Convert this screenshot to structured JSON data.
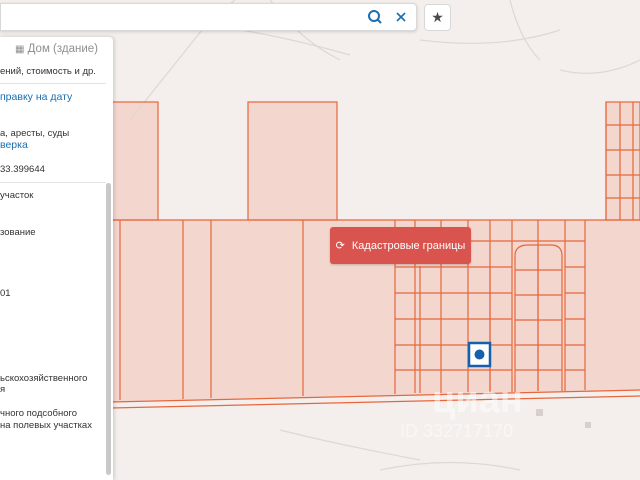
{
  "search": {
    "value": "",
    "search_icon": "search-icon",
    "clear_icon": "close-icon"
  },
  "favorite": {
    "icon": "star-icon"
  },
  "panel": {
    "title": "Дом (здание)",
    "title_icon": "building-icon",
    "line1": "ений, стоимость и др.",
    "link1": "правку на дату",
    "line2": "а, аресты, суды",
    "link2": "верка",
    "coords": "33.399644",
    "type_value": " участок",
    "usage_value": "зование",
    "code_fragment": "01",
    "category_line1": "ьскохозяйственного",
    "category_line2": "я",
    "use_line1": "чного подсобного",
    "use_line2": "на полевых участках"
  },
  "cadastral_button": {
    "label": "Кадастровые границы",
    "icon": "refresh-icon"
  },
  "watermark": {
    "brand": "циан",
    "id_text": "ID 332717170"
  },
  "colors": {
    "boundary": "#e8663c",
    "button": "#d9534f",
    "marker": "#1460aa",
    "link": "#1a6fb0"
  }
}
